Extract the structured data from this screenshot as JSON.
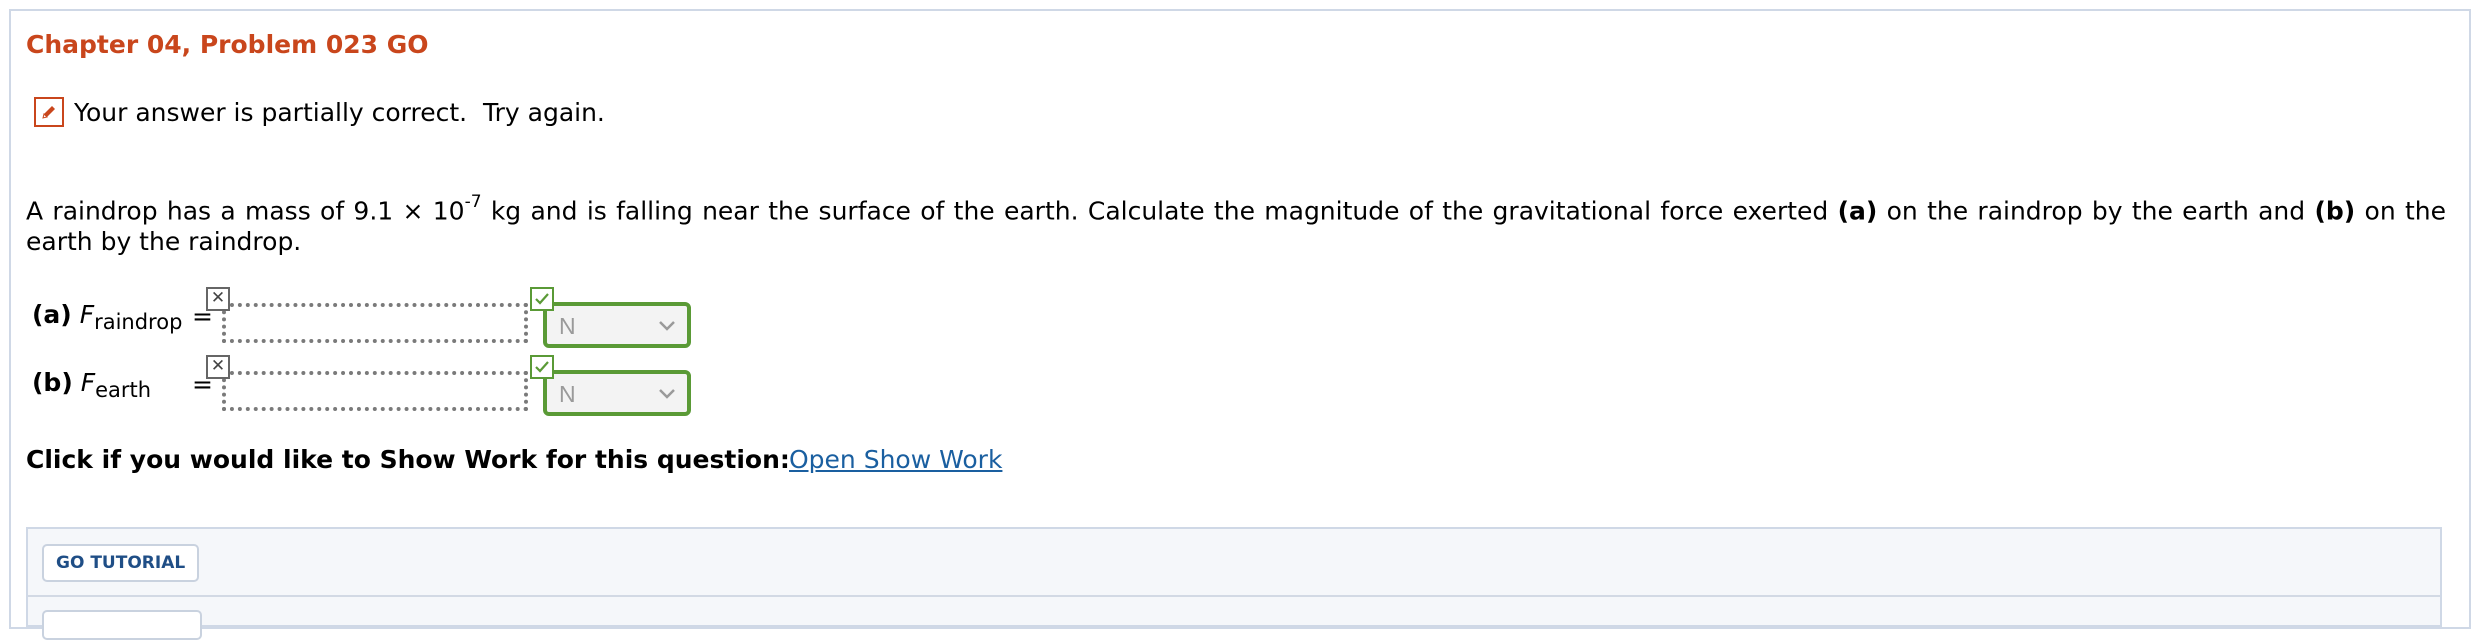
{
  "page": {
    "title": "Chapter 04, Problem 023 GO"
  },
  "status": {
    "message": "Your answer is partially correct.  Try again.",
    "icon": "pencil-icon",
    "color": "#c9461c"
  },
  "question": {
    "text_before_exponent": "A raindrop has a mass of 9.1 × 10",
    "exponent": "-7",
    "text_mid_1": " kg and is falling near the surface of the earth. Calculate the magnitude of the gravitational force exerted ",
    "bold_a": "(a)",
    "text_mid_2": " on the raindrop by the earth and ",
    "bold_b": "(b)",
    "text_end": " on the earth by the raindrop."
  },
  "parts": [
    {
      "tag": "(a)",
      "symbol": "F",
      "subscript": "raindrop",
      "equals": "=",
      "value": "",
      "input_status": "incorrect",
      "unit": "N",
      "unit_status": "correct"
    },
    {
      "tag": "(b)",
      "symbol": "F",
      "subscript": "earth",
      "equals": "=",
      "value": "",
      "input_status": "incorrect",
      "unit": "N",
      "unit_status": "correct"
    }
  ],
  "show_work": {
    "label": "Click if you would like to Show Work for this question:",
    "link": "Open Show Work"
  },
  "tutorial": {
    "button": "GO TUTORIAL"
  },
  "colors": {
    "title": "#c9461c",
    "correct": "#5a9a36",
    "link": "#1a5fa0",
    "panel_border": "#cfd8e6"
  }
}
